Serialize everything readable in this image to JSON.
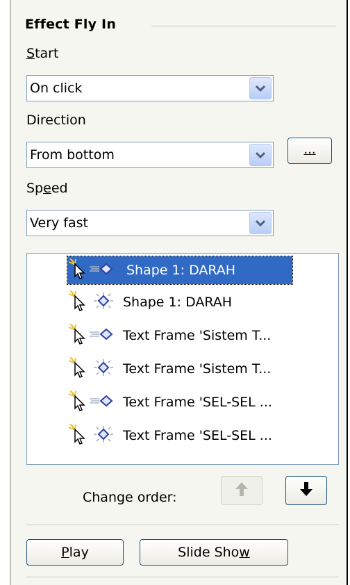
{
  "effect": {
    "group_title": "Effect Fly In",
    "start": {
      "label": "Start",
      "value": "On click"
    },
    "direction": {
      "label": "Direction",
      "value": "From bottom",
      "more_button": "..."
    },
    "speed": {
      "label": "Speed",
      "value": "Very fast"
    }
  },
  "animation_list": {
    "items": [
      {
        "label": "Shape 1: DARAH",
        "icon": "fly-in-effect-icon",
        "selected": true
      },
      {
        "label": "Shape 1: DARAH",
        "icon": "emphasis-effect-icon",
        "selected": false
      },
      {
        "label": "Text Frame 'Sistem T...",
        "icon": "fly-in-effect-icon",
        "selected": false
      },
      {
        "label": "Text Frame 'Sistem T...",
        "icon": "emphasis-effect-icon",
        "selected": false
      },
      {
        "label": "Text Frame 'SEL-SEL ...",
        "icon": "fly-in-effect-icon",
        "selected": false
      },
      {
        "label": "Text Frame 'SEL-SEL ...",
        "icon": "emphasis-effect-icon",
        "selected": false
      }
    ]
  },
  "order": {
    "label": "Change order:"
  },
  "buttons": {
    "play": "Play",
    "slide_show": "Slide Show"
  },
  "colors": {
    "selection": "#316ac5",
    "field_border": "#7f9db9",
    "button_border": "#1c5180",
    "panel": "#f6f6f0"
  }
}
